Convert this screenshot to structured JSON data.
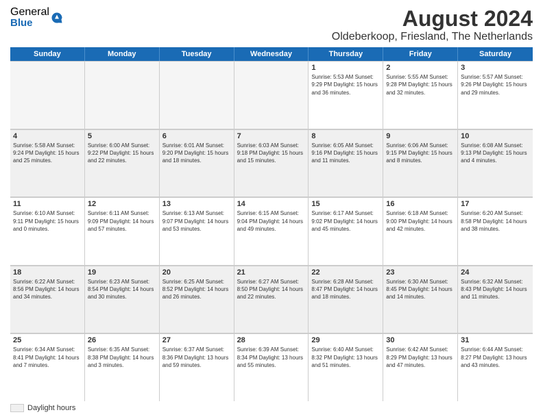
{
  "logo": {
    "general": "General",
    "blue": "Blue"
  },
  "title": "August 2024",
  "subtitle": "Oldeberkoop, Friesland, The Netherlands",
  "headers": [
    "Sunday",
    "Monday",
    "Tuesday",
    "Wednesday",
    "Thursday",
    "Friday",
    "Saturday"
  ],
  "weeks": [
    [
      {
        "day": "",
        "detail": "",
        "empty": true
      },
      {
        "day": "",
        "detail": "",
        "empty": true
      },
      {
        "day": "",
        "detail": "",
        "empty": true
      },
      {
        "day": "",
        "detail": "",
        "empty": true
      },
      {
        "day": "1",
        "detail": "Sunrise: 5:53 AM\nSunset: 9:29 PM\nDaylight: 15 hours\nand 36 minutes.",
        "empty": false
      },
      {
        "day": "2",
        "detail": "Sunrise: 5:55 AM\nSunset: 9:28 PM\nDaylight: 15 hours\nand 32 minutes.",
        "empty": false
      },
      {
        "day": "3",
        "detail": "Sunrise: 5:57 AM\nSunset: 9:26 PM\nDaylight: 15 hours\nand 29 minutes.",
        "empty": false
      }
    ],
    [
      {
        "day": "4",
        "detail": "Sunrise: 5:58 AM\nSunset: 9:24 PM\nDaylight: 15 hours\nand 25 minutes.",
        "empty": false
      },
      {
        "day": "5",
        "detail": "Sunrise: 6:00 AM\nSunset: 9:22 PM\nDaylight: 15 hours\nand 22 minutes.",
        "empty": false
      },
      {
        "day": "6",
        "detail": "Sunrise: 6:01 AM\nSunset: 9:20 PM\nDaylight: 15 hours\nand 18 minutes.",
        "empty": false
      },
      {
        "day": "7",
        "detail": "Sunrise: 6:03 AM\nSunset: 9:18 PM\nDaylight: 15 hours\nand 15 minutes.",
        "empty": false
      },
      {
        "day": "8",
        "detail": "Sunrise: 6:05 AM\nSunset: 9:16 PM\nDaylight: 15 hours\nand 11 minutes.",
        "empty": false
      },
      {
        "day": "9",
        "detail": "Sunrise: 6:06 AM\nSunset: 9:15 PM\nDaylight: 15 hours\nand 8 minutes.",
        "empty": false
      },
      {
        "day": "10",
        "detail": "Sunrise: 6:08 AM\nSunset: 9:13 PM\nDaylight: 15 hours\nand 4 minutes.",
        "empty": false
      }
    ],
    [
      {
        "day": "11",
        "detail": "Sunrise: 6:10 AM\nSunset: 9:11 PM\nDaylight: 15 hours\nand 0 minutes.",
        "empty": false
      },
      {
        "day": "12",
        "detail": "Sunrise: 6:11 AM\nSunset: 9:09 PM\nDaylight: 14 hours\nand 57 minutes.",
        "empty": false
      },
      {
        "day": "13",
        "detail": "Sunrise: 6:13 AM\nSunset: 9:07 PM\nDaylight: 14 hours\nand 53 minutes.",
        "empty": false
      },
      {
        "day": "14",
        "detail": "Sunrise: 6:15 AM\nSunset: 9:04 PM\nDaylight: 14 hours\nand 49 minutes.",
        "empty": false
      },
      {
        "day": "15",
        "detail": "Sunrise: 6:17 AM\nSunset: 9:02 PM\nDaylight: 14 hours\nand 45 minutes.",
        "empty": false
      },
      {
        "day": "16",
        "detail": "Sunrise: 6:18 AM\nSunset: 9:00 PM\nDaylight: 14 hours\nand 42 minutes.",
        "empty": false
      },
      {
        "day": "17",
        "detail": "Sunrise: 6:20 AM\nSunset: 8:58 PM\nDaylight: 14 hours\nand 38 minutes.",
        "empty": false
      }
    ],
    [
      {
        "day": "18",
        "detail": "Sunrise: 6:22 AM\nSunset: 8:56 PM\nDaylight: 14 hours\nand 34 minutes.",
        "empty": false
      },
      {
        "day": "19",
        "detail": "Sunrise: 6:23 AM\nSunset: 8:54 PM\nDaylight: 14 hours\nand 30 minutes.",
        "empty": false
      },
      {
        "day": "20",
        "detail": "Sunrise: 6:25 AM\nSunset: 8:52 PM\nDaylight: 14 hours\nand 26 minutes.",
        "empty": false
      },
      {
        "day": "21",
        "detail": "Sunrise: 6:27 AM\nSunset: 8:50 PM\nDaylight: 14 hours\nand 22 minutes.",
        "empty": false
      },
      {
        "day": "22",
        "detail": "Sunrise: 6:28 AM\nSunset: 8:47 PM\nDaylight: 14 hours\nand 18 minutes.",
        "empty": false
      },
      {
        "day": "23",
        "detail": "Sunrise: 6:30 AM\nSunset: 8:45 PM\nDaylight: 14 hours\nand 14 minutes.",
        "empty": false
      },
      {
        "day": "24",
        "detail": "Sunrise: 6:32 AM\nSunset: 8:43 PM\nDaylight: 14 hours\nand 11 minutes.",
        "empty": false
      }
    ],
    [
      {
        "day": "25",
        "detail": "Sunrise: 6:34 AM\nSunset: 8:41 PM\nDaylight: 14 hours\nand 7 minutes.",
        "empty": false
      },
      {
        "day": "26",
        "detail": "Sunrise: 6:35 AM\nSunset: 8:38 PM\nDaylight: 14 hours\nand 3 minutes.",
        "empty": false
      },
      {
        "day": "27",
        "detail": "Sunrise: 6:37 AM\nSunset: 8:36 PM\nDaylight: 13 hours\nand 59 minutes.",
        "empty": false
      },
      {
        "day": "28",
        "detail": "Sunrise: 6:39 AM\nSunset: 8:34 PM\nDaylight: 13 hours\nand 55 minutes.",
        "empty": false
      },
      {
        "day": "29",
        "detail": "Sunrise: 6:40 AM\nSunset: 8:32 PM\nDaylight: 13 hours\nand 51 minutes.",
        "empty": false
      },
      {
        "day": "30",
        "detail": "Sunrise: 6:42 AM\nSunset: 8:29 PM\nDaylight: 13 hours\nand 47 minutes.",
        "empty": false
      },
      {
        "day": "31",
        "detail": "Sunrise: 6:44 AM\nSunset: 8:27 PM\nDaylight: 13 hours\nand 43 minutes.",
        "empty": false
      }
    ]
  ],
  "legend": {
    "label": "Daylight hours"
  }
}
